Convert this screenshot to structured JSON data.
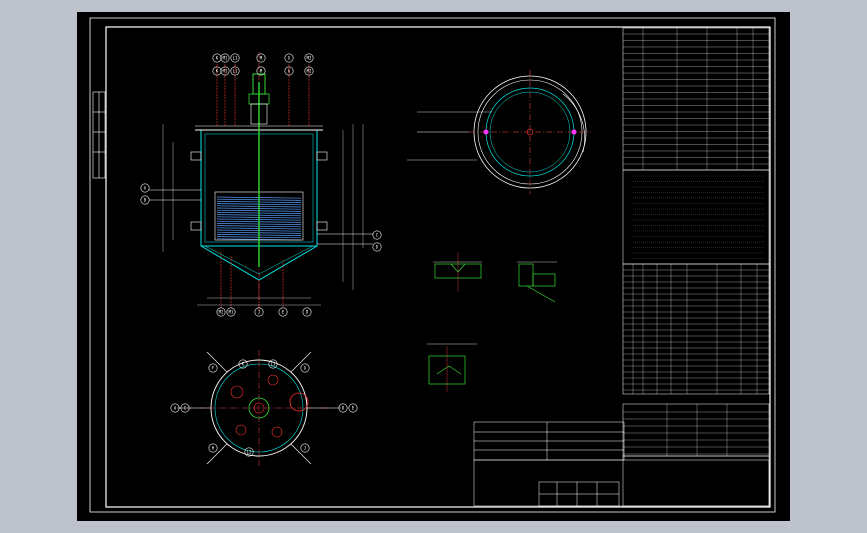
{
  "drawing": {
    "background": "#000000",
    "workspace_color": "#bdc2cc",
    "line_colors": {
      "outline": "#ffffff",
      "vessel": "#00e5e5",
      "coil": "#5aa0ff",
      "nozzle": "#ff3333",
      "center": "#ff4444",
      "agitator": "#33dd33",
      "dimension": "#e8e8e8",
      "marker": "#ff33ff"
    }
  },
  "nozzle_tags_top": [
    "K",
    "M1",
    "L1",
    "M",
    "G",
    "M2"
  ],
  "nozzle_tags_bottom": [
    "M2",
    "M1",
    "J",
    "E",
    "D"
  ],
  "nozzle_tags_side_left": [
    "A",
    "B"
  ],
  "nozzle_tags_side_right": [
    "C",
    "D"
  ],
  "plan_view_tags": [
    "A",
    "C",
    "D",
    "E",
    "F",
    "G",
    "H",
    "J",
    "K",
    "L1",
    "L2"
  ],
  "detail_views": [
    "I",
    "II",
    "III",
    "IV"
  ],
  "title_block": {
    "rows": 4,
    "signature_rows": 2
  }
}
